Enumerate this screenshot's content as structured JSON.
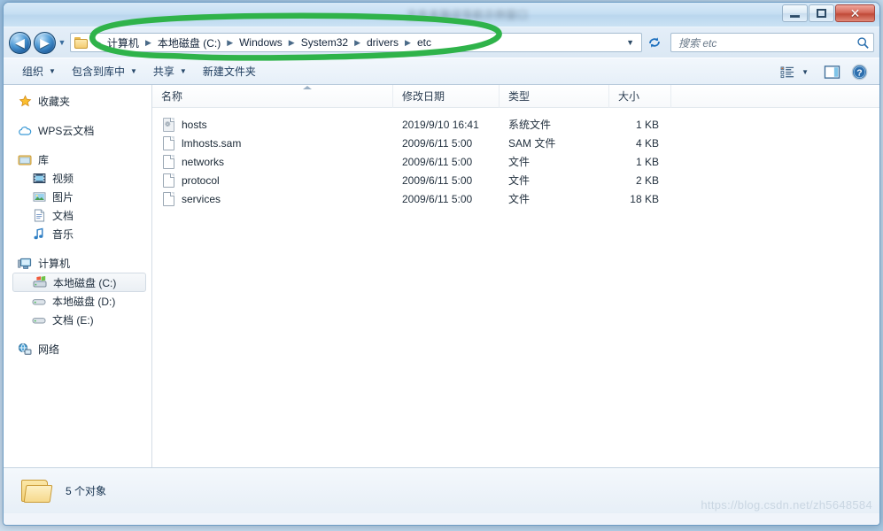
{
  "window": {
    "title_blurred": "文件夹路径导航示例窗口",
    "controls": {
      "minimize_label": "最小化",
      "maximize_label": "最大化",
      "close_label": "✕"
    }
  },
  "navigation": {
    "back_label": "◀",
    "forward_label": "▶",
    "recent_caret": "▼",
    "breadcrumb": [
      "计算机",
      "本地磁盘 (C:)",
      "Windows",
      "System32",
      "drivers",
      "etc"
    ],
    "separator": "▶",
    "address_caret": "▼",
    "refresh_icon": "refresh-icon"
  },
  "search": {
    "placeholder": "搜索 etc",
    "icon": "search-icon"
  },
  "toolbar": {
    "items": [
      {
        "label": "组织",
        "caret": "▼"
      },
      {
        "label": "包含到库中",
        "caret": "▼"
      },
      {
        "label": "共享",
        "caret": "▼"
      },
      {
        "label": "新建文件夹",
        "caret": ""
      }
    ],
    "view_caret": "▼"
  },
  "sidebar": {
    "items": [
      {
        "label": "收藏夹",
        "icon": "star-icon",
        "level": 0
      },
      {
        "label": "WPS云文档",
        "icon": "cloud-icon",
        "level": 0
      },
      {
        "label": "库",
        "icon": "library-icon",
        "level": 0
      },
      {
        "label": "视频",
        "icon": "video-icon",
        "level": 1
      },
      {
        "label": "图片",
        "icon": "picture-icon",
        "level": 1
      },
      {
        "label": "文档",
        "icon": "document-icon",
        "level": 1
      },
      {
        "label": "音乐",
        "icon": "music-icon",
        "level": 1
      },
      {
        "label": "计算机",
        "icon": "computer-icon",
        "level": 0
      },
      {
        "label": "本地磁盘 (C:)",
        "icon": "system-drive-icon",
        "level": 1,
        "selected": true
      },
      {
        "label": "本地磁盘 (D:)",
        "icon": "drive-icon",
        "level": 1
      },
      {
        "label": "文档 (E:)",
        "icon": "drive-icon",
        "level": 1
      },
      {
        "label": "网络",
        "icon": "network-icon",
        "level": 0
      }
    ]
  },
  "filelist": {
    "columns": [
      "名称",
      "修改日期",
      "类型",
      "大小"
    ],
    "sort_column": "名称",
    "sort_direction": "asc",
    "rows": [
      {
        "name": "hosts",
        "date": "2019/9/10 16:41",
        "type": "系统文件",
        "size": "1 KB",
        "icon": "system-file-icon"
      },
      {
        "name": "lmhosts.sam",
        "date": "2009/6/11 5:00",
        "type": "SAM 文件",
        "size": "4 KB",
        "icon": "file-icon"
      },
      {
        "name": "networks",
        "date": "2009/6/11 5:00",
        "type": "文件",
        "size": "1 KB",
        "icon": "file-icon"
      },
      {
        "name": "protocol",
        "date": "2009/6/11 5:00",
        "type": "文件",
        "size": "2 KB",
        "icon": "file-icon"
      },
      {
        "name": "services",
        "date": "2009/6/11 5:00",
        "type": "文件",
        "size": "18 KB",
        "icon": "file-icon"
      }
    ]
  },
  "statusbar": {
    "text": "5 个对象",
    "icon": "open-folder-icon"
  },
  "watermark": "https://blog.csdn.net/zh5648584",
  "annotation": {
    "color": "#2fb34a",
    "shape": "hand-drawn-ellipse",
    "target": "breadcrumb-path"
  }
}
